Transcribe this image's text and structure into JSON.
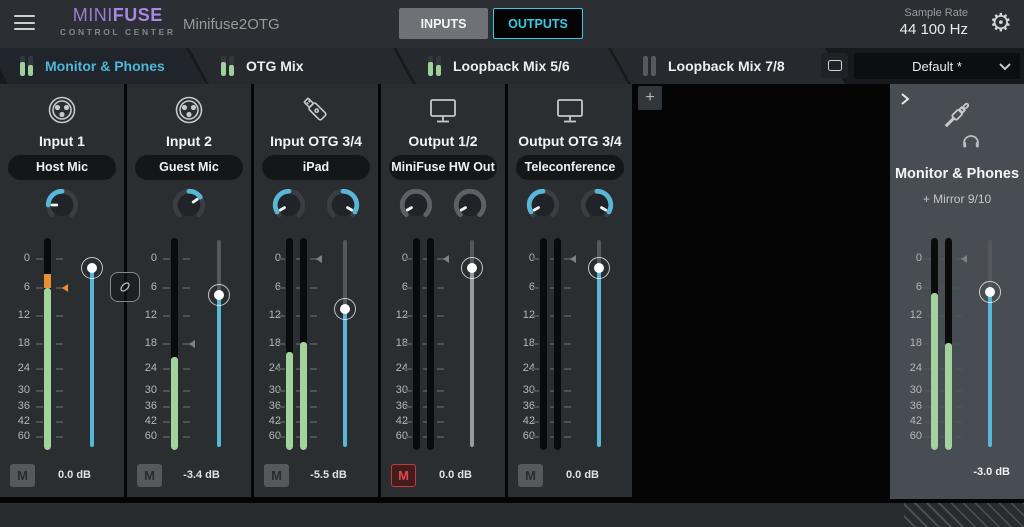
{
  "topbar": {
    "logo_primary": "MINI",
    "logo_secondary": "FUSE",
    "logo_subtitle": "CONTROL CENTER",
    "device_name": "Minifuse2OTG",
    "inputs_button": "INPUTS",
    "outputs_button": "OUTPUTS",
    "sample_rate_label": "Sample Rate",
    "sample_rate_value": "44 100 Hz"
  },
  "tabbar": {
    "preset_value": "Default *",
    "tabs": [
      {
        "label": "Monitor & Phones",
        "active": true,
        "meters": [
          {
            "pct": 70,
            "color": "#9fcf9a"
          },
          {
            "pct": 56,
            "color": "#9fcf9a"
          }
        ]
      },
      {
        "label": "OTG Mix",
        "active": false,
        "meters": [
          {
            "pct": 70,
            "color": "#9fcf9a"
          },
          {
            "pct": 56,
            "color": "#9fcf9a"
          }
        ]
      },
      {
        "label": "Loopback Mix 5/6",
        "active": false,
        "meters": [
          {
            "pct": 70,
            "color": "#9fcf9a"
          },
          {
            "pct": 56,
            "color": "#9fcf9a"
          }
        ]
      },
      {
        "label": "Loopback Mix 7/8",
        "active": false,
        "meters": [
          {
            "pct": 100,
            "color": "#56595d"
          },
          {
            "pct": 100,
            "color": "#56595d"
          }
        ]
      }
    ]
  },
  "mixer": {
    "add_channel_label": "+",
    "scale_ticks": [
      {
        "label": "0",
        "pct": 10
      },
      {
        "label": "6",
        "pct": 23.5
      },
      {
        "label": "12",
        "pct": 37
      },
      {
        "label": "18",
        "pct": 50
      },
      {
        "label": "24",
        "pct": 62
      },
      {
        "label": "30",
        "pct": 72
      },
      {
        "label": "36",
        "pct": 79.5
      },
      {
        "label": "42",
        "pct": 87
      },
      {
        "label": "60",
        "pct": 94
      }
    ],
    "channels": [
      {
        "name": "Input 1",
        "device_label": "Host Mic",
        "icon": "xlr-icon",
        "stereo": false,
        "knobs": [
          {
            "arc_from": -90,
            "arc_to": 0,
            "color": "#58b7d9",
            "pointer": -90
          }
        ],
        "meters": [
          {
            "level_top_pct": 23.5,
            "orange_top_pct": 17
          }
        ],
        "peak_marker": {
          "pct": 23.5,
          "color": "#e78f35"
        },
        "fader": {
          "pct": 14,
          "color": "#58b7d9",
          "stub": false
        },
        "muted": false,
        "mute_label": "M",
        "db_value": "0.0 dB"
      },
      {
        "name": "Input 2",
        "device_label": "Guest Mic",
        "icon": "xlr-icon",
        "stereo": false,
        "knobs": [
          {
            "arc_from": 0,
            "arc_to": 55,
            "color": "#58b7d9",
            "pointer": 55
          }
        ],
        "meters": [
          {
            "level_top_pct": 56
          }
        ],
        "peak_marker": {
          "pct": 50,
          "color": "#7d8185"
        },
        "fader": {
          "pct": 27,
          "color": "#58b7d9",
          "stub": true
        },
        "muted": false,
        "mute_label": "M",
        "db_value": "-3.4 dB"
      },
      {
        "name": "Input OTG 3/4",
        "device_label": "iPad",
        "icon": "usb-icon",
        "stereo": true,
        "knobs": [
          {
            "arc_from": -120,
            "arc_to": 0,
            "color": "#58b7d9",
            "pointer": -120
          },
          {
            "arc_from": 0,
            "arc_to": 120,
            "color": "#58b7d9",
            "pointer": 120
          }
        ],
        "meters": [
          {
            "level_top_pct": 54
          },
          {
            "level_top_pct": 49
          }
        ],
        "peak_marker": {
          "pct": 10,
          "color": "#7d8185"
        },
        "fader": {
          "pct": 33.5,
          "color": "#58b7d9",
          "stub": true
        },
        "muted": false,
        "mute_label": "M",
        "db_value": "-5.5 dB"
      },
      {
        "name": "Output 1/2",
        "device_label": "MiniFuse HW Out",
        "icon": "display-icon",
        "stereo": true,
        "knobs": [
          {
            "arc_from": -135,
            "arc_to": 135,
            "color": "#5d6165",
            "pointer": -120
          },
          {
            "arc_from": -135,
            "arc_to": 135,
            "color": "#5d6165",
            "pointer": -120
          }
        ],
        "meters": [
          {
            "level_top_pct": 100
          },
          {
            "level_top_pct": 100
          }
        ],
        "peak_marker": {
          "pct": 10,
          "color": "#7d8185"
        },
        "fader": {
          "pct": 14,
          "color": "#979b9f",
          "stub": true
        },
        "muted": true,
        "mute_label": "M",
        "db_value": "0.0 dB"
      },
      {
        "name": "Output OTG 3/4",
        "device_label": "Teleconference",
        "icon": "display-icon",
        "stereo": true,
        "knobs": [
          {
            "arc_from": -120,
            "arc_to": 0,
            "color": "#58b7d9",
            "pointer": -120
          },
          {
            "arc_from": 0,
            "arc_to": 120,
            "color": "#58b7d9",
            "pointer": 120
          }
        ],
        "meters": [
          {
            "level_top_pct": 100
          },
          {
            "level_top_pct": 100
          }
        ],
        "peak_marker": {
          "pct": 10,
          "color": "#7d8185"
        },
        "fader": {
          "pct": 14,
          "color": "#58b7d9",
          "stub": true
        },
        "muted": false,
        "mute_label": "M",
        "db_value": "0.0 dB"
      }
    ],
    "master": {
      "title": "Monitor & Phones",
      "subtitle": "+ Mirror 9/10",
      "icon": "jack-headphones-icon",
      "meters": [
        {
          "level_top_pct": 26
        },
        {
          "level_top_pct": 49.5
        }
      ],
      "peak_marker": {
        "pct": 10,
        "color": "#7d8185"
      },
      "fader": {
        "pct": 25.5,
        "color": "#58b7d9",
        "stub": true
      },
      "db_value": "-3.0 dB"
    }
  }
}
